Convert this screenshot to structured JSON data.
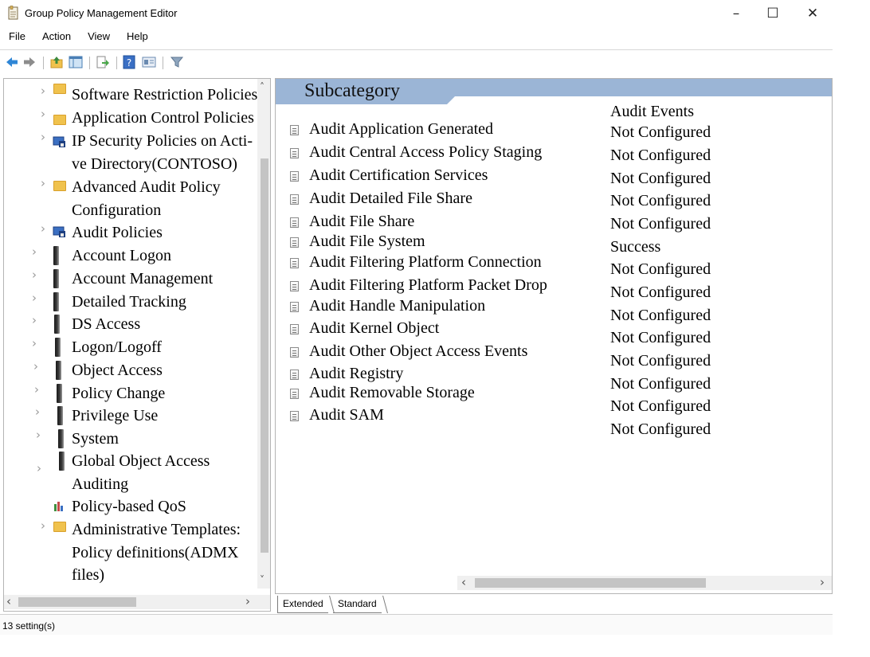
{
  "window": {
    "title": "Group Policy Management Editor",
    "controls": {
      "minimize": "–",
      "maximize": "☐",
      "close": "✕"
    }
  },
  "menu": [
    "File",
    "Action",
    "View",
    "Help"
  ],
  "toolbar": [
    "back-icon",
    "forward-icon",
    "up-folder-icon",
    "show-hide-tree-icon",
    "export-list-icon",
    "help-icon",
    "properties-icon",
    "filter-icon"
  ],
  "tree": {
    "items": [
      {
        "label": "Software Restriction Policies",
        "icon": "folder-icon"
      },
      {
        "label": "Application Control Policies",
        "icon": "folder-icon"
      },
      {
        "label": "IP Security Policies on Acti-",
        "label2": "ve Directory(CONTOSO)",
        "icon": "ip-security-icon"
      },
      {
        "label": "Advanced Audit Policy",
        "label2": "Configuration",
        "icon": "folder-icon"
      },
      {
        "label": "Audit Policies",
        "icon": "audit-policies-icon"
      },
      {
        "label": "Account Logon",
        "icon": "book-icon"
      },
      {
        "label": "Account Management",
        "icon": "book-icon"
      },
      {
        "label": "Detailed Tracking",
        "icon": "book-icon"
      },
      {
        "label": "DS Access",
        "icon": "book-icon"
      },
      {
        "label": "Logon/Logoff",
        "icon": "book-icon"
      },
      {
        "label": "Object Access",
        "icon": "book-icon"
      },
      {
        "label": "Policy Change",
        "icon": "book-icon"
      },
      {
        "label": "Privilege Use",
        "icon": "book-icon"
      },
      {
        "label": "System",
        "icon": "book-icon"
      },
      {
        "label": "Global Object Access",
        "label2": "Auditing",
        "icon": "book-icon"
      },
      {
        "label": "Policy-based QoS",
        "icon": "qos-chart-icon"
      },
      {
        "label": "Administrative Templates:",
        "label2": "Policy definitions(ADMX",
        "label3": "files)",
        "icon": "folder-icon"
      }
    ]
  },
  "list": {
    "header_subcategory": "Subcategory",
    "header_audit_events": "Audit Events",
    "rows": [
      {
        "subcategory": "Audit Application Generated"
      },
      {
        "subcategory": "Audit Central Access Policy Staging"
      },
      {
        "subcategory": "Audit Certification Services"
      },
      {
        "subcategory": "Audit Detailed File Share"
      },
      {
        "subcategory": "Audit File Share"
      },
      {
        "subcategory": "Audit File System"
      },
      {
        "subcategory": "Audit Filtering Platform Connection"
      },
      {
        "subcategory": "Audit Filtering Platform Packet Drop"
      },
      {
        "subcategory": "Audit Handle Manipulation"
      },
      {
        "subcategory": "Audit Kernel Object"
      },
      {
        "subcategory": "Audit Other Object Access Events"
      },
      {
        "subcategory": "Audit Registry"
      },
      {
        "subcategory": "Audit Removable Storage"
      },
      {
        "subcategory": "Audit SAM"
      }
    ],
    "audit_values": [
      "Not Configured",
      "Not Configured",
      "Not Configured",
      "Not Configured",
      "Not Configured",
      "Success",
      "Not Configured",
      "Not Configured",
      "Not Configured",
      "Not Configured",
      "Not Configured",
      "Not Configured",
      "Not Configured",
      "Not Configured"
    ]
  },
  "tabs": [
    "Extended",
    "Standard"
  ],
  "status": "13 setting(s)",
  "colors": {
    "header_blue": "#9bb5d6",
    "folder": "#f0c24d"
  }
}
